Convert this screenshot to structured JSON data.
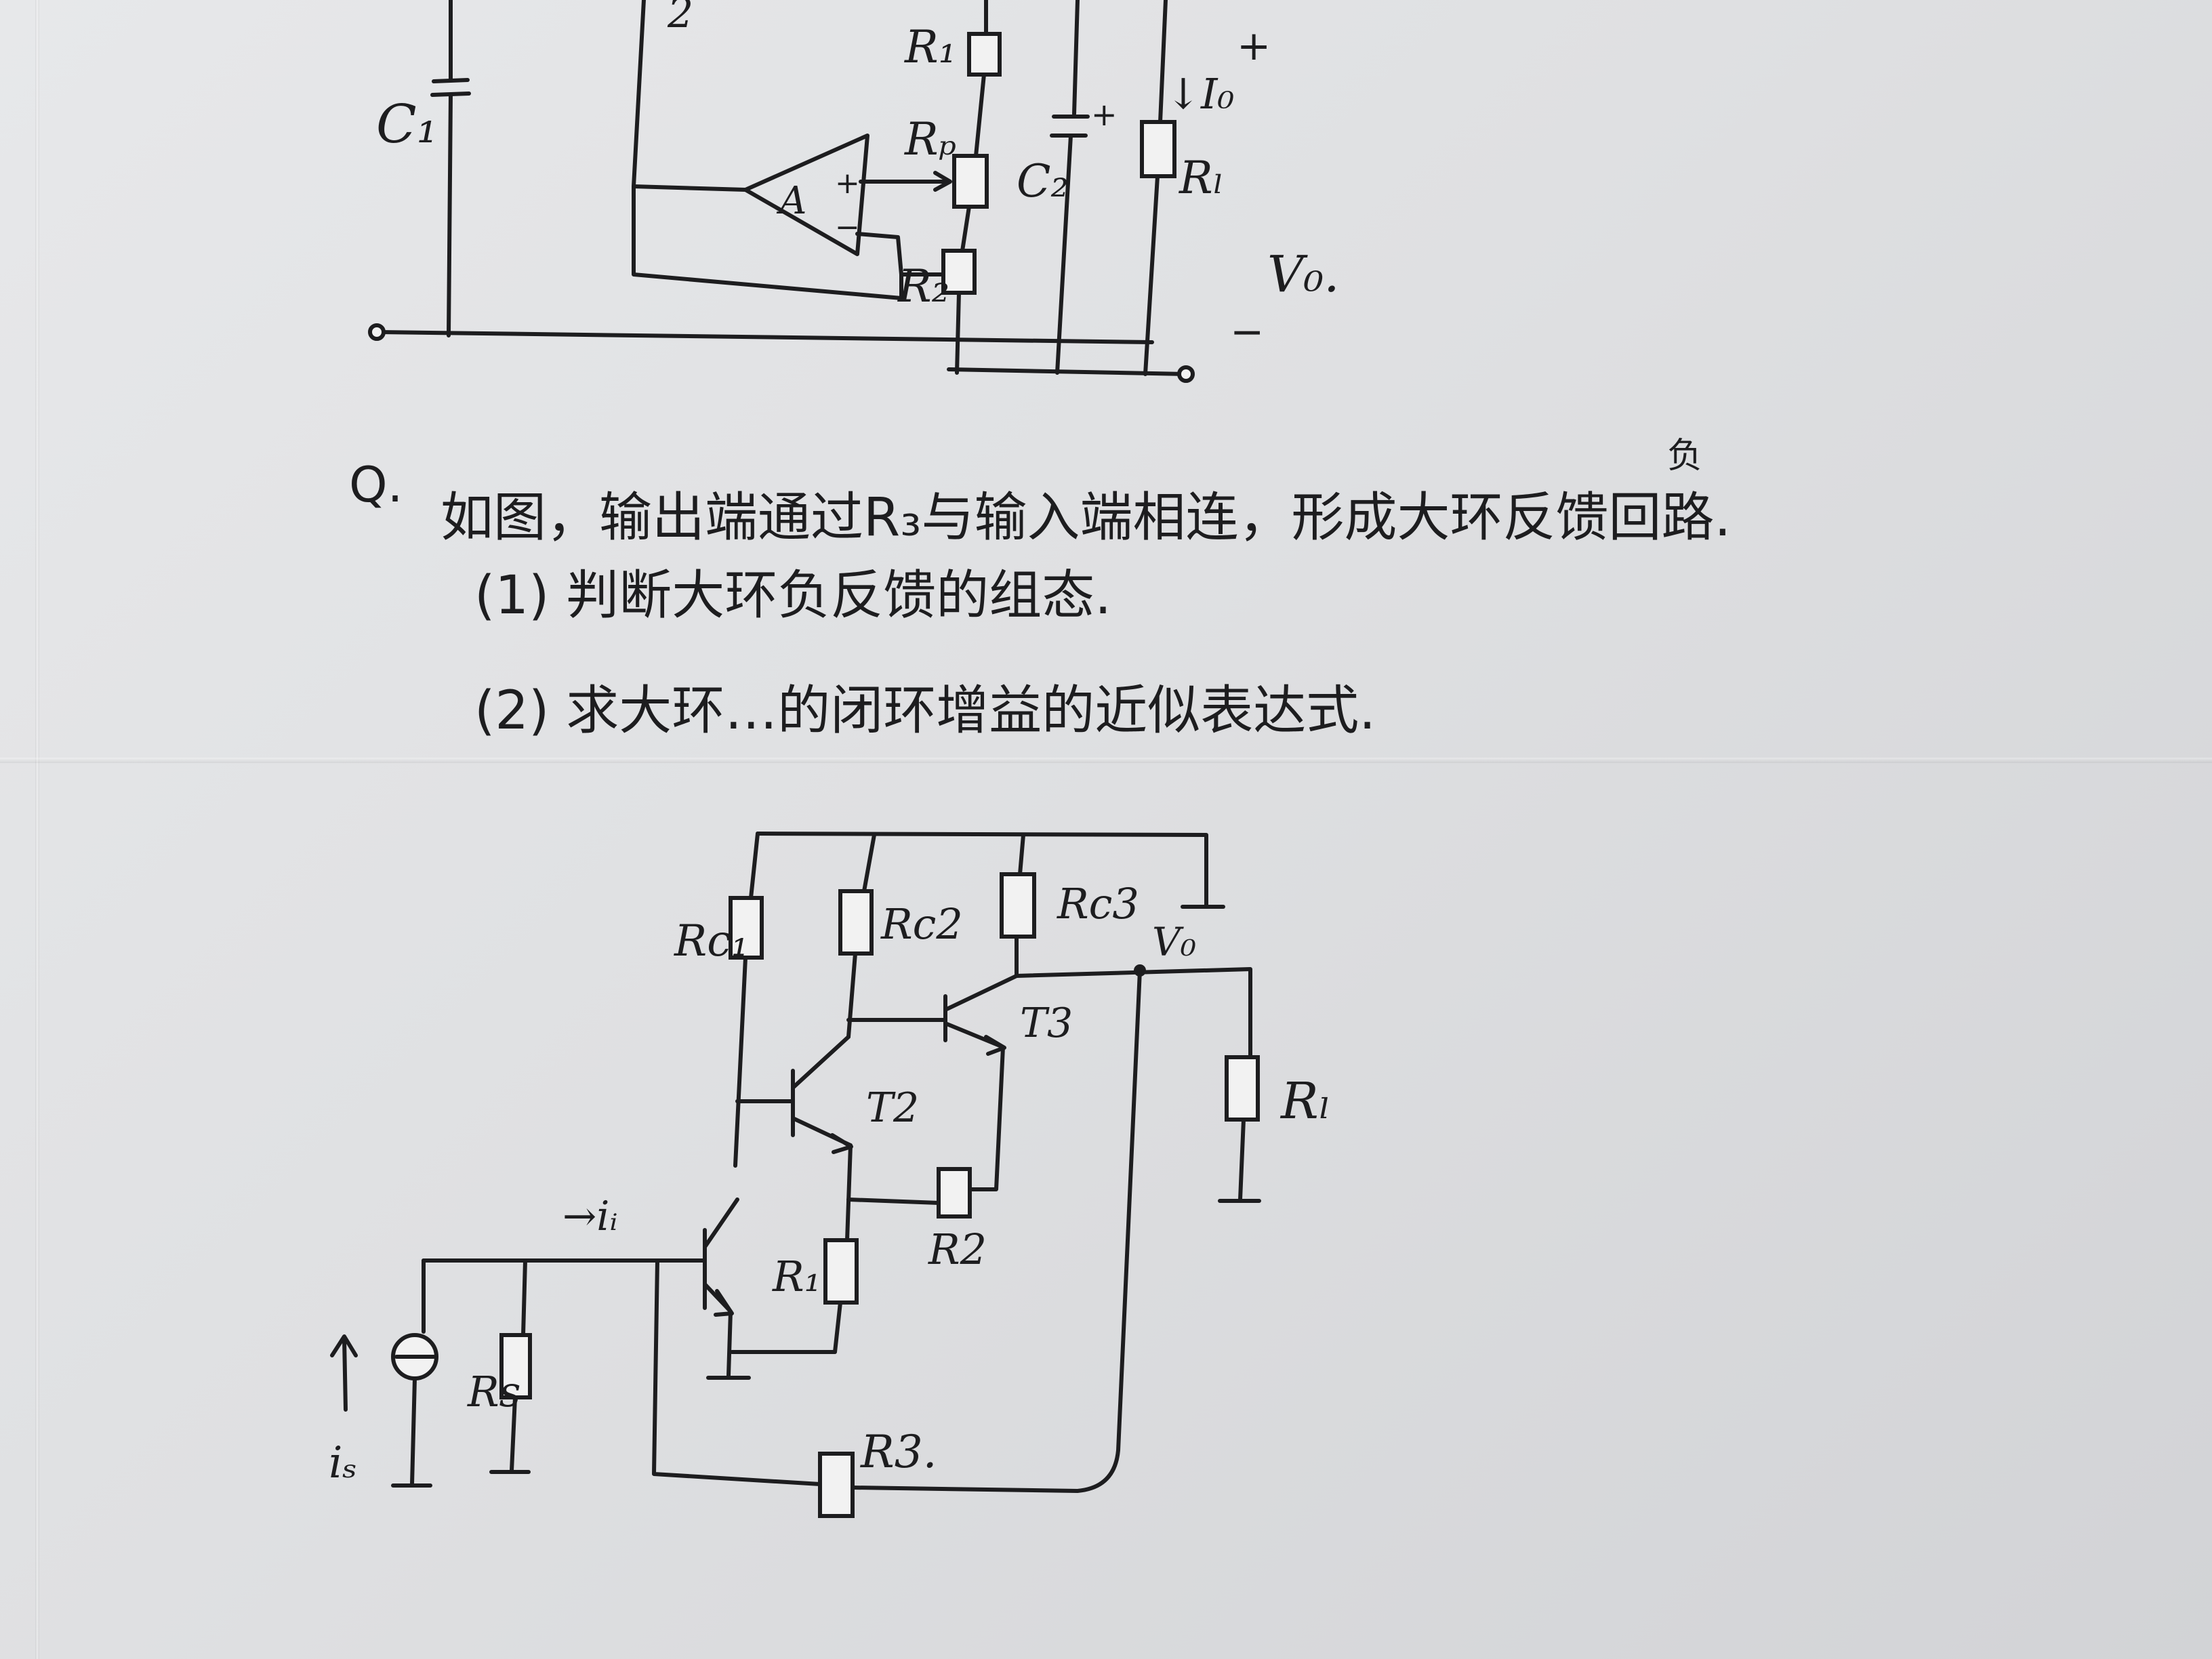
{
  "top_circuit": {
    "labels": {
      "node2": "2",
      "c1": "C₁",
      "r1": "R₁",
      "rp": "Rₚ",
      "r2": "R₂",
      "c2": "C₂",
      "io": "↓I₀",
      "rl": "Rₗ",
      "vo": "V₀.",
      "plus_top": "+",
      "minus_bottom": "−",
      "amp": "A",
      "amp_plus": "+",
      "amp_minus": "−",
      "c2_plus": "+"
    }
  },
  "question": {
    "number": "Q.",
    "line1": "如图，输出端通过R₃与输入端相连，形成大环反馈回路.",
    "insert_mark": "负",
    "item1": "(1) 判断大环负反馈的组态.",
    "item2": "(2) 求大环…的闭环增益的近似表达式."
  },
  "bottom_circuit": {
    "labels": {
      "rc1": "Rc₁",
      "rc2": "Rc2",
      "rc3": "Rc3",
      "vo": "V₀",
      "t3": "T3",
      "t2": "T2",
      "rl": "Rₗ",
      "ii": "→iᵢ",
      "r1": "R₁",
      "r2": "R2",
      "rs": "Rs",
      "is": "iₛ",
      "r3": "R3."
    }
  }
}
